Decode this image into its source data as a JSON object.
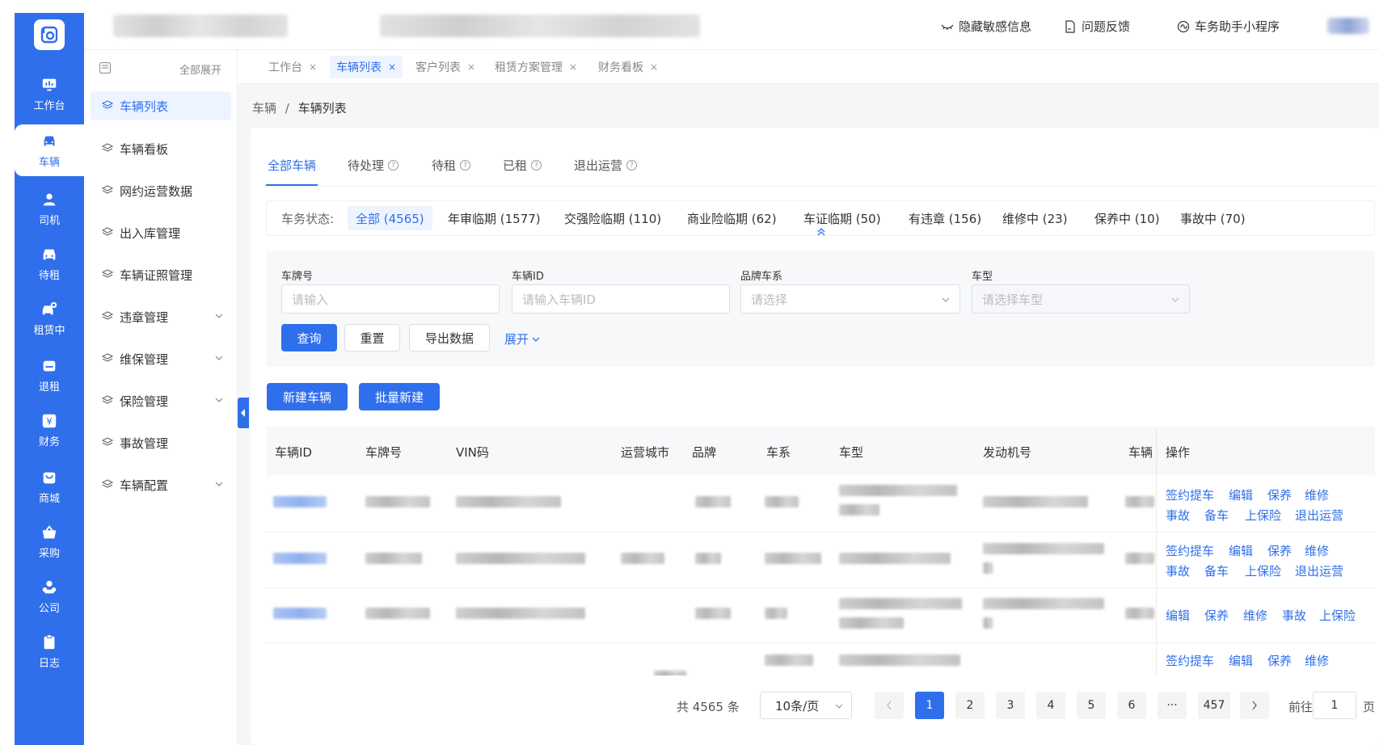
{
  "topbar": {
    "hide_sensitive": "隐藏敏感信息",
    "feedback": "问题反馈",
    "mini_program": "车务助手小程序"
  },
  "rail": {
    "items": [
      {
        "label": "工作台",
        "icon": "monitor-icon"
      },
      {
        "label": "车辆",
        "icon": "car-icon"
      },
      {
        "label": "司机",
        "icon": "driver-icon"
      },
      {
        "label": "待租",
        "icon": "car-front-icon"
      },
      {
        "label": "租赁中",
        "icon": "car-rental-icon"
      },
      {
        "label": "退租",
        "icon": "car-return-icon"
      },
      {
        "label": "财务",
        "icon": "yen-icon"
      },
      {
        "label": "商城",
        "icon": "shop-bag-icon"
      },
      {
        "label": "采购",
        "icon": "basket-icon"
      },
      {
        "label": "公司",
        "icon": "company-icon"
      },
      {
        "label": "日志",
        "icon": "clipboard-icon"
      }
    ]
  },
  "submenu": {
    "expand_all": "全部展开",
    "items": [
      {
        "label": "车辆列表"
      },
      {
        "label": "车辆看板"
      },
      {
        "label": "网约运营数据"
      },
      {
        "label": "出入库管理"
      },
      {
        "label": "车辆证照管理"
      },
      {
        "label": "违章管理"
      },
      {
        "label": "维保管理"
      },
      {
        "label": "保险管理"
      },
      {
        "label": "事故管理"
      },
      {
        "label": "车辆配置"
      }
    ]
  },
  "page_tabs": [
    {
      "label": "工作台"
    },
    {
      "label": "车辆列表"
    },
    {
      "label": "客户列表"
    },
    {
      "label": "租赁方案管理"
    },
    {
      "label": "财务看板"
    }
  ],
  "close_glyph": "×",
  "breadcrumb": {
    "parent": "车辆",
    "sep": "/",
    "current": "车辆列表"
  },
  "main_tabs": [
    {
      "label": "全部车辆"
    },
    {
      "label": "待处理"
    },
    {
      "label": "待租"
    },
    {
      "label": "已租"
    },
    {
      "label": "退出运营"
    }
  ],
  "status": {
    "label": "车务状态:",
    "chips": [
      {
        "label": "全部 (4565)"
      },
      {
        "label": "年审临期 (1577)"
      },
      {
        "label": "交强险临期 (110)"
      },
      {
        "label": "商业险临期 (62)"
      },
      {
        "label": "车证临期 (50)"
      },
      {
        "label": "有违章 (156)"
      },
      {
        "label": "维修中 (23)"
      },
      {
        "label": "保养中 (10)"
      },
      {
        "label": "事故中 (70)"
      }
    ]
  },
  "filters": {
    "plate": {
      "label": "车牌号",
      "placeholder": "请输入"
    },
    "vehicle_id": {
      "label": "车辆ID",
      "placeholder": "请输入车辆ID"
    },
    "brand": {
      "label": "品牌车系",
      "placeholder": "请选择"
    },
    "model": {
      "label": "车型",
      "placeholder": "请选择车型"
    },
    "query": "查询",
    "reset": "重置",
    "export": "导出数据",
    "expand": "展开"
  },
  "actions": {
    "new_vehicle": "新建车辆",
    "batch_new": "批量新建"
  },
  "table": {
    "columns": [
      "车辆ID",
      "车牌号",
      "VIN码",
      "运营城市",
      "品牌",
      "车系",
      "车型",
      "发动机号",
      "车辆",
      "操作"
    ],
    "rows": [
      {
        "ops": [
          "签约提车",
          "编辑",
          "保养",
          "维修",
          "事故",
          "备车",
          "上保险",
          "退出运营"
        ]
      },
      {
        "ops": [
          "签约提车",
          "编辑",
          "保养",
          "维修",
          "事故",
          "备车",
          "上保险",
          "退出运营"
        ]
      },
      {
        "ops": [
          "编辑",
          "保养",
          "维修",
          "事故",
          "上保险"
        ]
      },
      {
        "ops": [
          "签约提车",
          "编辑",
          "保养",
          "维修"
        ]
      }
    ]
  },
  "pagination": {
    "total": "共 4565 条",
    "page_size": "10条/页",
    "pages": [
      "1",
      "2",
      "3",
      "4",
      "5",
      "6",
      "···",
      "457"
    ],
    "current": "1",
    "goto_prefix": "前往",
    "goto_value": "1",
    "goto_suffix": "页"
  },
  "colors": {
    "primary": "#2f6fec",
    "rail": "#2f6fec",
    "bg": "#f5f6f8"
  }
}
